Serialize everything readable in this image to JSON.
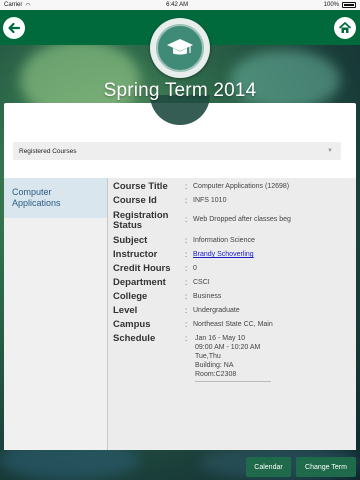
{
  "status_bar": {
    "carrier": "Carrier",
    "time": "6:42 AM",
    "battery": "100%"
  },
  "header": {
    "title": "Spring Term 2014"
  },
  "dropdown": {
    "selected": "Registered Courses"
  },
  "sidebar": {
    "items": [
      {
        "label": "Computer Applications"
      }
    ]
  },
  "details": {
    "rows": [
      {
        "label": "Course Title",
        "value": "Computer Applications (12698)"
      },
      {
        "label": "Course Id",
        "value": "INFS 1010"
      },
      {
        "label": "Registration Status",
        "value": "Web Dropped after classes beg"
      },
      {
        "label": "Subject",
        "value": "Information Science"
      },
      {
        "label": "Instructor",
        "value": "Brandy Schoverling"
      },
      {
        "label": "Credit Hours",
        "value": "0"
      },
      {
        "label": "Department",
        "value": "CSCI"
      },
      {
        "label": "College",
        "value": "Business"
      },
      {
        "label": "Level",
        "value": "Undergraduate"
      },
      {
        "label": "Campus",
        "value": "Northeast State CC, Main"
      },
      {
        "label": "Schedule",
        "lines": [
          "Jan 16 - May 10",
          "09:00 AM - 10:20 AM",
          "Tue,Thu",
          "Building: NA",
          "Room:C2308"
        ]
      }
    ]
  },
  "footer": {
    "calendar_label": "Calendar",
    "change_term_label": "Change Term"
  },
  "icons": {
    "back": "back-arrow-icon",
    "home": "home-icon",
    "logo": "graduation-cap-icon"
  },
  "colors": {
    "brand_green": "#006a3d",
    "button_green": "#1e6a4a",
    "link_blue": "#1b1bcc"
  }
}
